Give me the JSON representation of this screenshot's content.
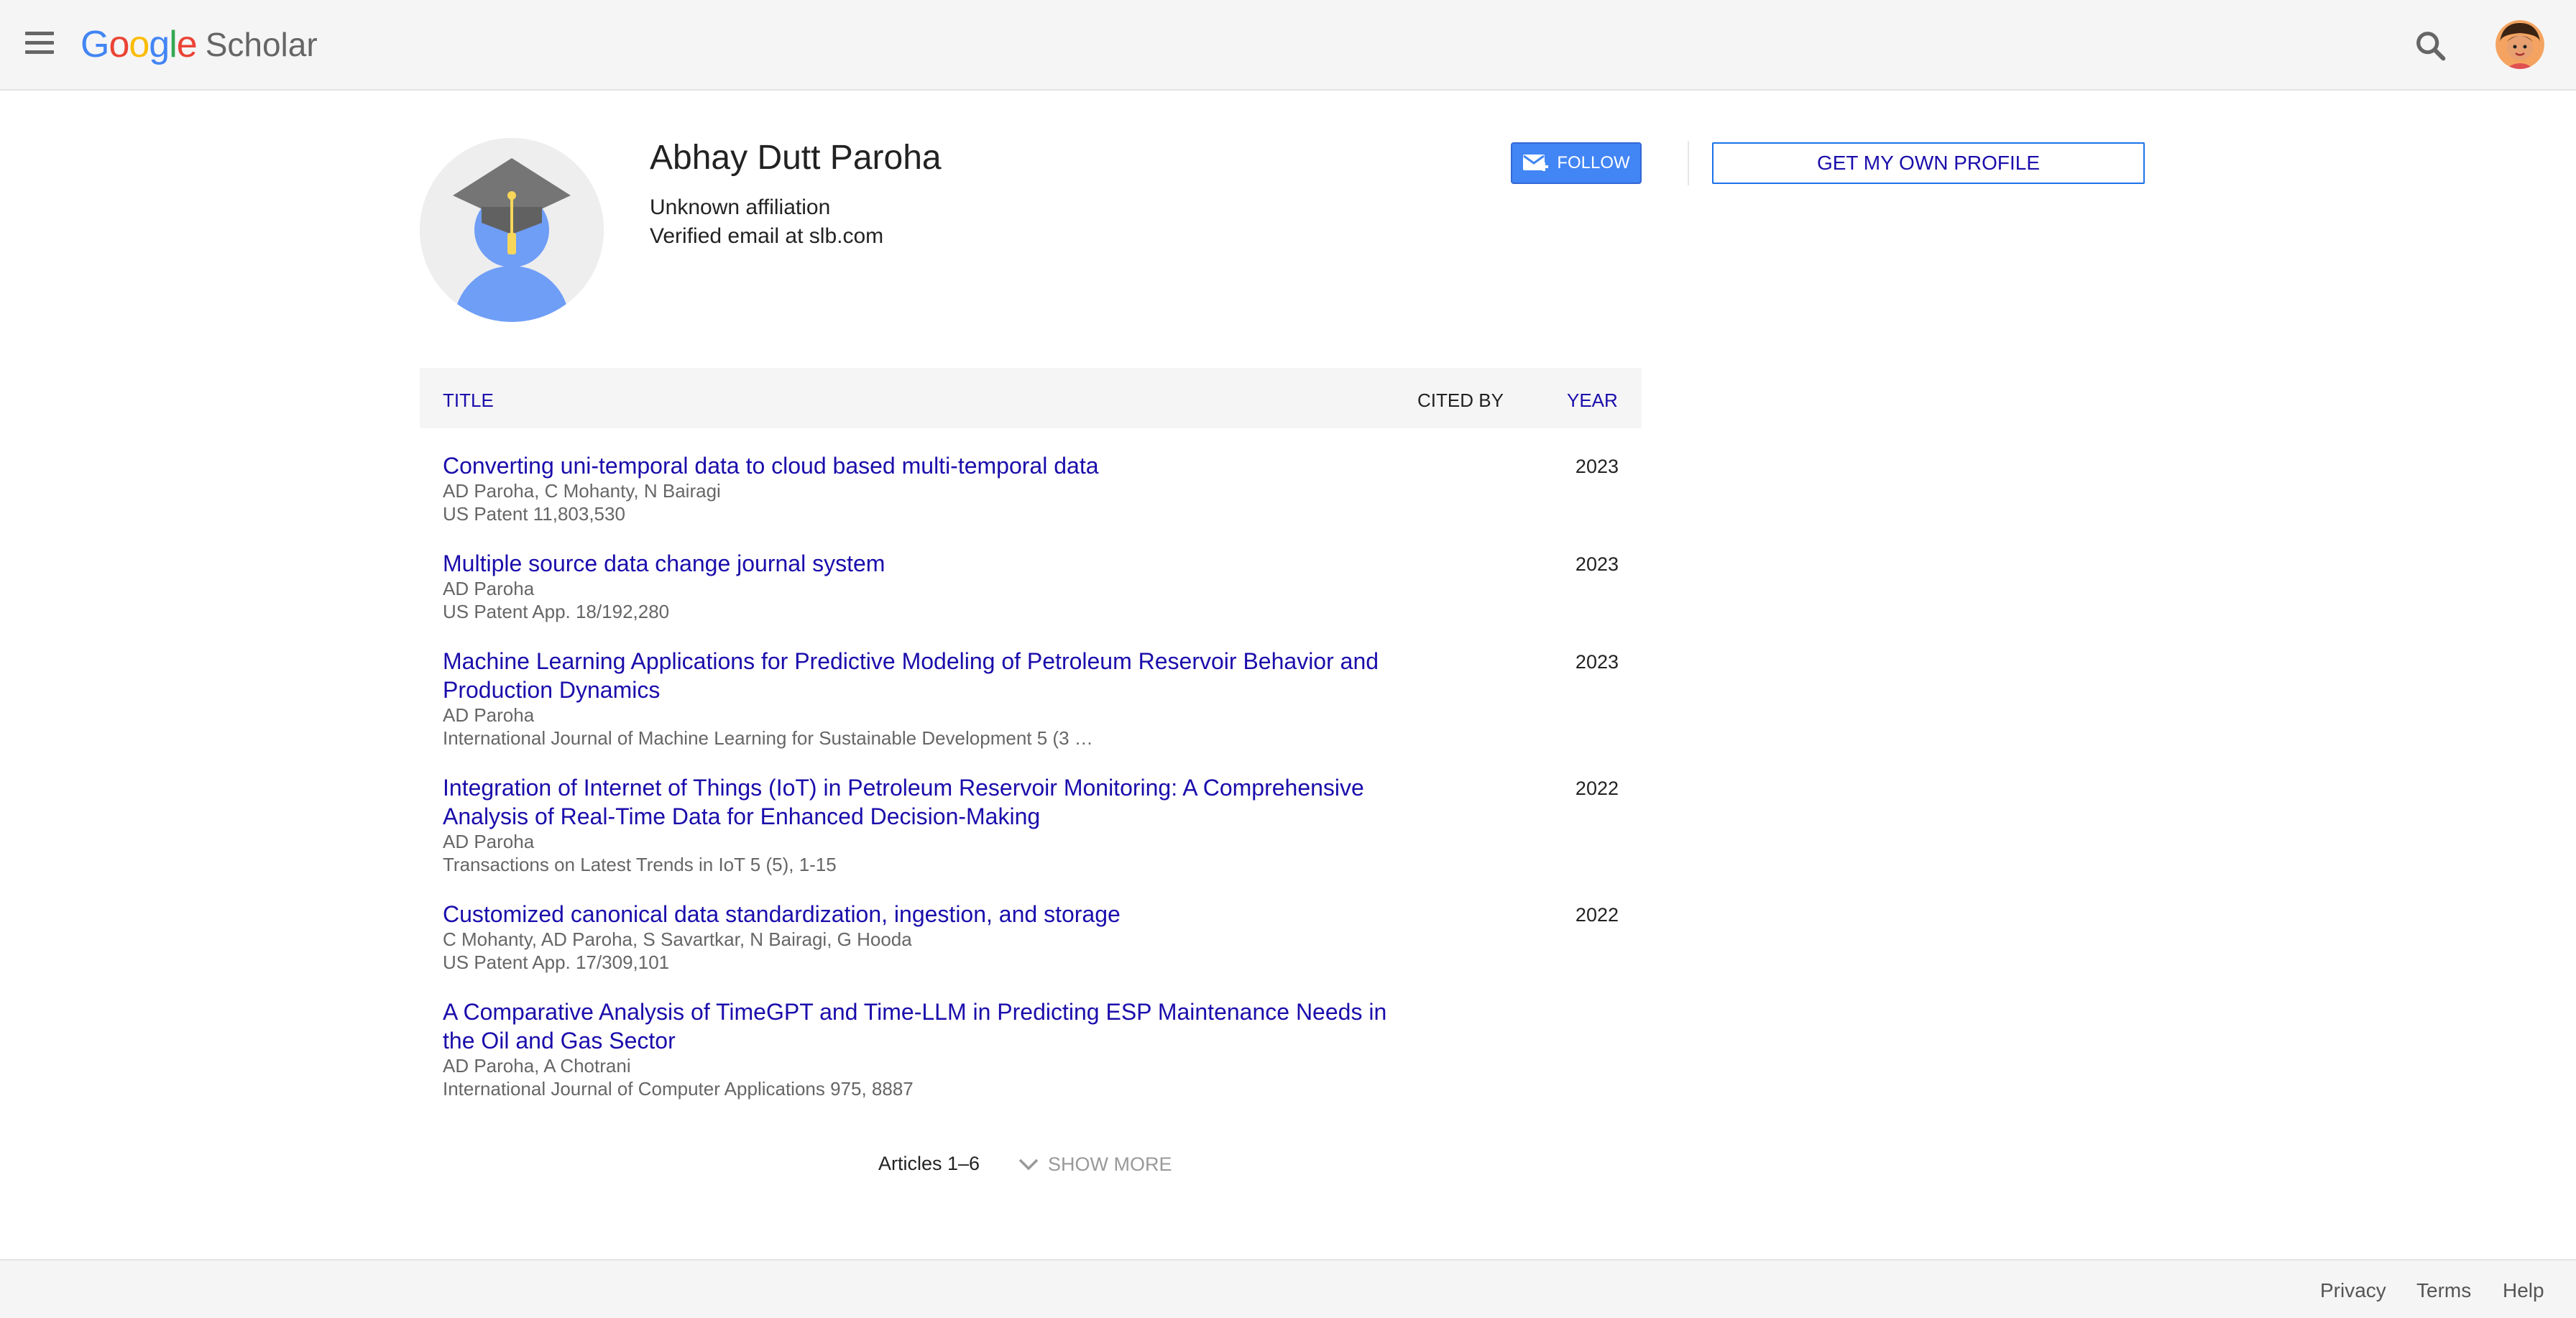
{
  "header": {
    "logo_google": "Google",
    "logo_scholar": "Scholar",
    "icons": {
      "menu": "hamburger-icon",
      "search": "search-icon",
      "account": "user-avatar"
    }
  },
  "profile": {
    "name": "Abhay Dutt Paroha",
    "affiliation": "Unknown affiliation",
    "email": "Verified email at slb.com",
    "follow_label": "FOLLOW",
    "get_profile_label": "GET MY OWN PROFILE"
  },
  "table": {
    "headers": {
      "title": "TITLE",
      "cited_by": "CITED BY",
      "year": "YEAR"
    },
    "rows": [
      {
        "title": "Converting uni-temporal data to cloud based multi-temporal data",
        "authors": "AD Paroha, C Mohanty, N Bairagi",
        "venue": "US Patent 11,803,530",
        "year": "2023"
      },
      {
        "title": "Multiple source data change journal system",
        "authors": "AD Paroha",
        "venue": "US Patent App. 18/192,280",
        "year": "2023"
      },
      {
        "title": "Machine Learning Applications for Predictive Modeling of Petroleum Reservoir Behavior and Production Dynamics",
        "authors": "AD Paroha",
        "venue": "International Journal of Machine Learning for Sustainable Development 5 (3 …",
        "year": "2023"
      },
      {
        "title": "Integration of Internet of Things (IoT) in Petroleum Reservoir Monitoring: A Comprehensive Analysis of Real-Time Data for Enhanced Decision-Making",
        "authors": "AD Paroha",
        "venue": "Transactions on Latest Trends in IoT 5 (5), 1-15",
        "year": "2022"
      },
      {
        "title": "Customized canonical data standardization, ingestion, and storage",
        "authors": "C Mohanty, AD Paroha, S Savartkar, N Bairagi, G Hooda",
        "venue": "US Patent App. 17/309,101",
        "year": "2022"
      },
      {
        "title": "A Comparative Analysis of TimeGPT and Time-LLM in Predicting ESP Maintenance Needs in the Oil and Gas Sector",
        "authors": "AD Paroha, A Chotrani",
        "venue": "International Journal of Computer Applications 975, 8887",
        "year": ""
      }
    ]
  },
  "pagination": {
    "articles": "Articles 1–6",
    "show_more": "SHOW MORE"
  },
  "footer": {
    "privacy": "Privacy",
    "terms": "Terms",
    "help": "Help"
  }
}
